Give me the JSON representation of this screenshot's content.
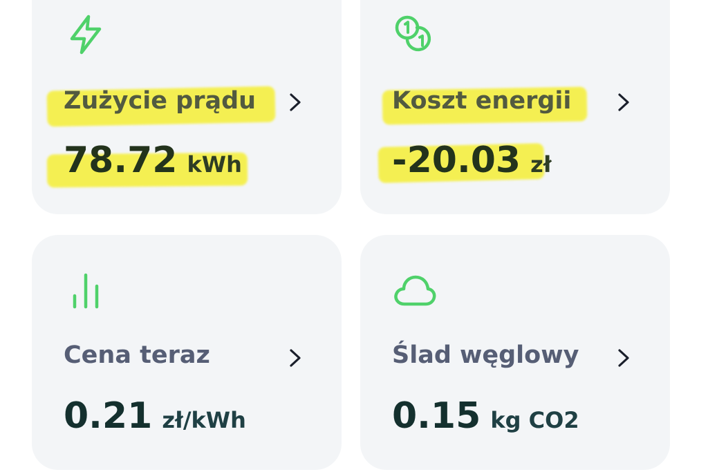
{
  "colors": {
    "card_background": "#f3f5f7",
    "icon_green": "#4fd16a",
    "label_text": "#565e75",
    "value_text": "#14302e",
    "highlighter": "#f5ef3c"
  },
  "cards": [
    {
      "icon": "lightning-bolt-icon",
      "label": "Zużycie prądu",
      "value": "78.72",
      "unit": "kWh",
      "highlighted": true
    },
    {
      "icon": "coins-icon",
      "label": "Koszt energii",
      "value": "-20.03",
      "unit": "zł",
      "highlighted": true
    },
    {
      "icon": "bar-chart-icon",
      "label": "Cena teraz",
      "value": "0.21",
      "unit": "zł/kWh",
      "highlighted": false
    },
    {
      "icon": "cloud-icon",
      "label": "Ślad węglowy",
      "value": "0.15",
      "unit": "kg CO2",
      "highlighted": false
    }
  ]
}
